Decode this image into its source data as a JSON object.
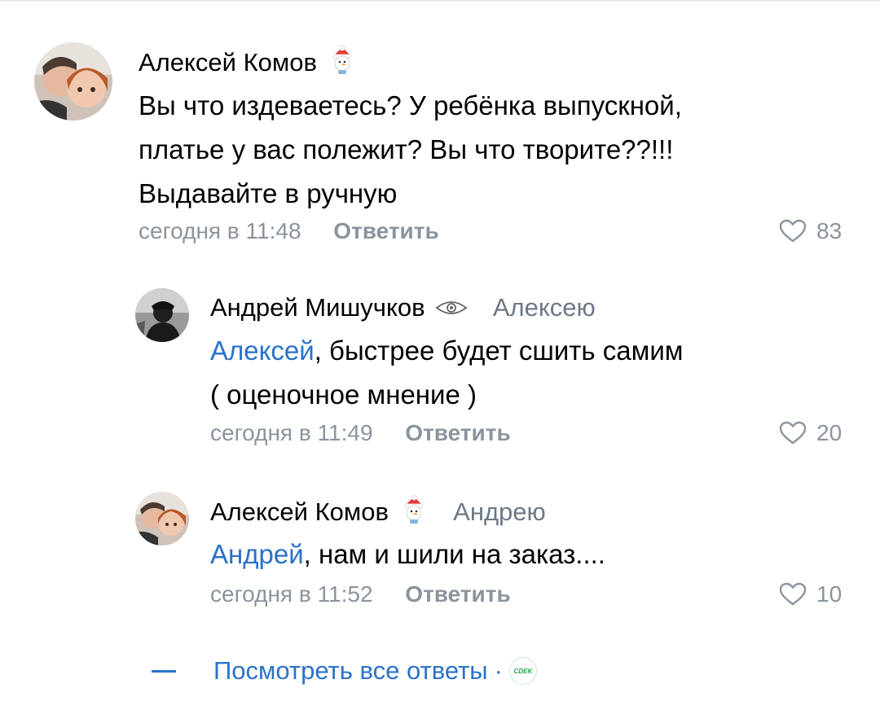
{
  "comments": [
    {
      "author": "Алексей Комов",
      "reply_to": "",
      "mention": "",
      "text_lines": [
        "Вы что издеваетесь? У ребёнка выпускной,",
        "платье у вас полежит? Вы что творите??!!!",
        "Выдавайте в ручную"
      ],
      "time": "сегодня в 11:48",
      "reply_label": "Ответить",
      "likes": "83",
      "avatar_icon": "user-photo-avatar",
      "badge_icon": "christmas-snowman-badge-icon"
    },
    {
      "author": "Андрей Мишучков",
      "reply_to": "Алексею",
      "mention": "Алексей",
      "text_lines": [
        ", быстрее будет сшить самим",
        "( оценочное мнение )"
      ],
      "time": "сегодня в 11:49",
      "reply_label": "Ответить",
      "likes": "20",
      "avatar_icon": "user-photo-avatar",
      "badge_icon": "eye-badge-icon"
    },
    {
      "author": "Алексей Комов",
      "reply_to": "Андрею",
      "mention": "Андрей",
      "text_lines": [
        ", нам и шили на заказ...."
      ],
      "time": "сегодня в 11:52",
      "reply_label": "Ответить",
      "likes": "10",
      "avatar_icon": "user-photo-avatar",
      "badge_icon": "christmas-snowman-badge-icon"
    }
  ],
  "show_all": {
    "label": "Посмотреть все ответы",
    "separator": "·",
    "logo_text": "CDEK"
  },
  "colors": {
    "link": "#2a72c9",
    "meta": "#8b949e"
  }
}
